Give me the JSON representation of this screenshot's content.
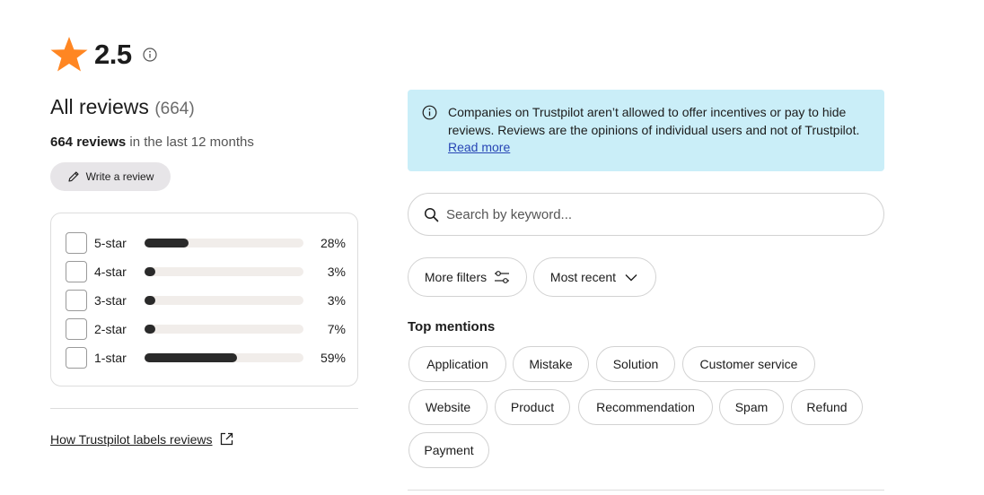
{
  "rating": {
    "value": "2.5",
    "star_color": "#ff8622"
  },
  "summary": {
    "heading": "All reviews",
    "count": "(664)",
    "period_count": "664 reviews",
    "period_text": " in the last 12 months"
  },
  "write_review": {
    "label": "Write a review"
  },
  "distribution": [
    {
      "label": "5-star",
      "percent_text": "28%",
      "percent": 28
    },
    {
      "label": "4-star",
      "percent_text": "3%",
      "percent": 3
    },
    {
      "label": "3-star",
      "percent_text": "3%",
      "percent": 3
    },
    {
      "label": "2-star",
      "percent_text": "7%",
      "percent": 7
    },
    {
      "label": "1-star",
      "percent_text": "59%",
      "percent": 59
    }
  ],
  "labels_link": {
    "label": "How Trustpilot labels reviews"
  },
  "notice": {
    "text": "Companies on Trustpilot aren’t allowed to offer incentives or pay to hide reviews. Reviews are the opinions of individual users and not of Trustpilot. ",
    "link": "Read more",
    "background": "#caeef8"
  },
  "search": {
    "placeholder": "Search by keyword..."
  },
  "filters": {
    "more_filters": "More filters",
    "sort": "Most recent"
  },
  "mentions": {
    "heading": "Top mentions",
    "chips": [
      "Application",
      "Mistake",
      "Solution",
      "Customer service",
      "Website",
      "Product",
      "Recommendation",
      "Spam",
      "Refund",
      "Payment"
    ]
  }
}
